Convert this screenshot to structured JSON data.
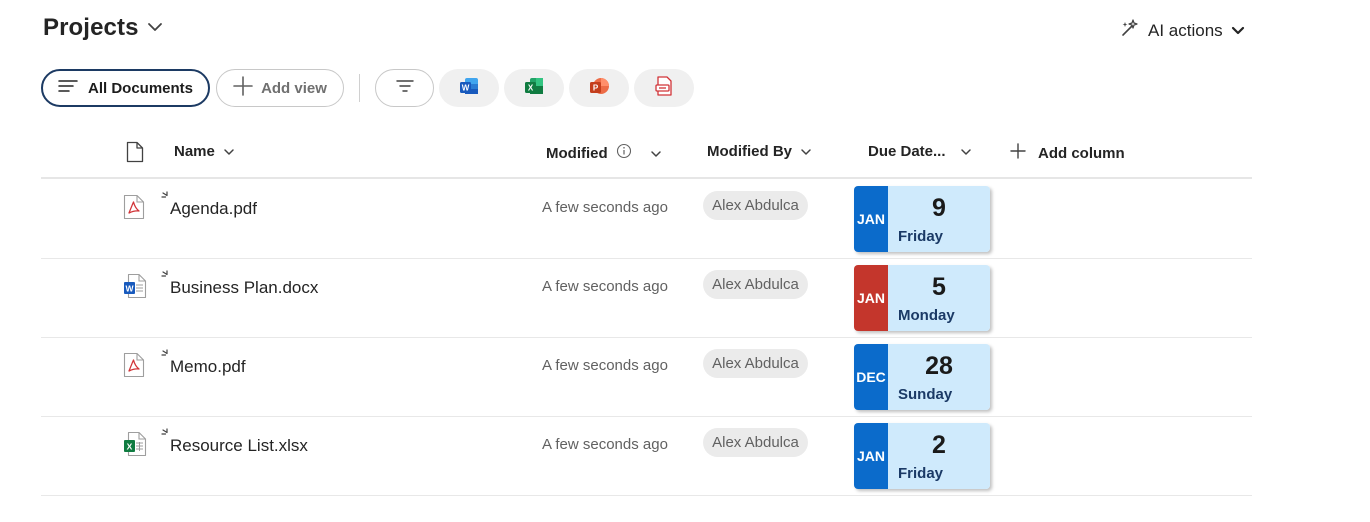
{
  "header": {
    "title": "Projects",
    "ai_actions": "AI actions"
  },
  "toolbar": {
    "all_documents": "All Documents",
    "add_view": "Add view"
  },
  "columns": {
    "name": "Name",
    "modified": "Modified",
    "modified_by": "Modified By",
    "due_date": "Due Date...",
    "add_column": "Add column"
  },
  "colors": {
    "blue_month": "#0b6bcb",
    "red_month": "#c4362c",
    "date_bg": "#cfeafc",
    "active_border": "#1c3a63"
  },
  "rows": [
    {
      "file_type": "pdf",
      "name": "Agenda.pdf",
      "modified": "A few seconds ago",
      "modified_by": "Alex Abdulca",
      "due_month": "JAN",
      "due_day": "9",
      "due_weekday": "Friday",
      "month_color": "#0b6bcb"
    },
    {
      "file_type": "docx",
      "name": "Business Plan.docx",
      "modified": "A few seconds ago",
      "modified_by": "Alex Abdulca",
      "due_month": "JAN",
      "due_day": "5",
      "due_weekday": "Monday",
      "month_color": "#c4362c"
    },
    {
      "file_type": "pdf",
      "name": "Memo.pdf",
      "modified": "A few seconds ago",
      "modified_by": "Alex Abdulca",
      "due_month": "DEC",
      "due_day": "28",
      "due_weekday": "Sunday",
      "month_color": "#0b6bcb"
    },
    {
      "file_type": "xlsx",
      "name": "Resource List.xlsx",
      "modified": "A few seconds ago",
      "modified_by": "Alex Abdulca",
      "due_month": "JAN",
      "due_day": "2",
      "due_weekday": "Friday",
      "month_color": "#0b6bcb"
    }
  ]
}
